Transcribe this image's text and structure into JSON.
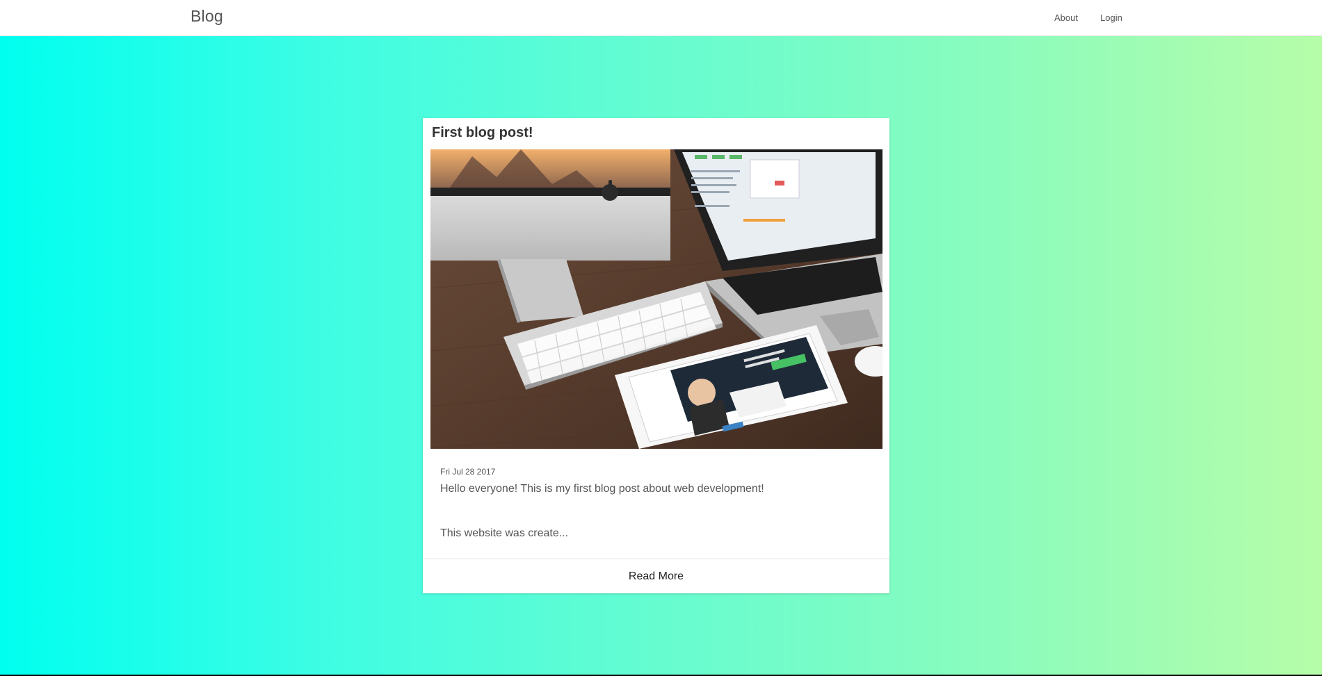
{
  "navbar": {
    "brand": "Blog",
    "links": [
      "About",
      "Login"
    ]
  },
  "post": {
    "title": "First blog post!",
    "image_alt": "desktop computer, keyboard, laptop and tablet on a wooden desk",
    "date": "Fri Jul 28 2017",
    "excerpt_line_1": "Hello everyone! This is my first blog post about web development!",
    "excerpt_line_2": "This website was create...",
    "read_more_label": "Read More"
  },
  "colors": {
    "gradient_start": "#00fff0",
    "gradient_end": "#b6fda8",
    "navbar_bg": "#ffffff",
    "card_bg": "#ffffff",
    "text": "#555555"
  }
}
